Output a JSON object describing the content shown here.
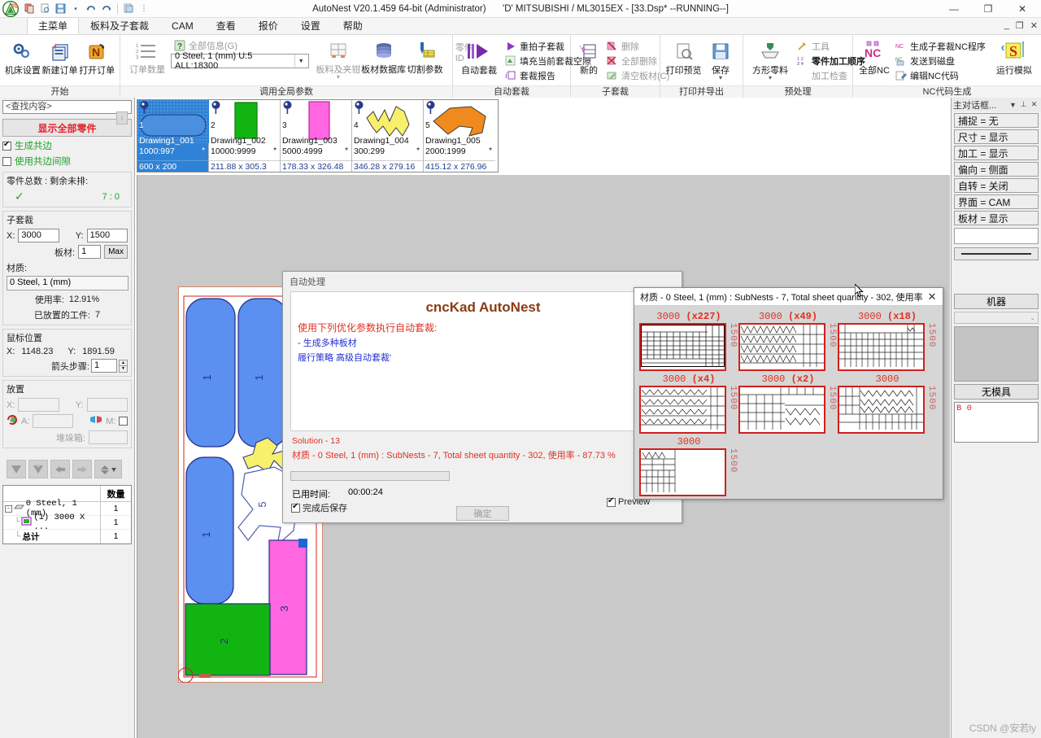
{
  "titlebar": {
    "app_title": "AutoNest V20.1.459 64-bit (Administrator)",
    "doc_title": "'D' MITSUBISHI / ML3015EX   - [33.Dsp* --RUNNING--]",
    "quick_access": [
      "copy-icon",
      "print-preview-icon",
      "save-icon",
      "dropdown-icon",
      "undo-icon",
      "redo-icon",
      "customize-icon",
      "more-icon"
    ],
    "minimize": "—",
    "maximize": "❐",
    "close": "✕",
    "mdi_minimize": "_",
    "mdi_restore": "❐",
    "mdi_close": "✕"
  },
  "tabs": [
    {
      "label": "主菜单",
      "active": true
    },
    {
      "label": "板料及子套裁",
      "active": false
    },
    {
      "label": "CAM",
      "active": false
    },
    {
      "label": "查看",
      "active": false
    },
    {
      "label": "报价",
      "active": false
    },
    {
      "label": "设置",
      "active": false
    },
    {
      "label": "帮助",
      "active": false
    }
  ],
  "ribbon": {
    "groups": [
      {
        "name": "开始",
        "label": "开始",
        "big": [
          {
            "label": "机床设置",
            "icon": "gears-icon"
          },
          {
            "label": "新建订单",
            "icon": "new-order-icon"
          },
          {
            "label": "打开订单",
            "icon": "open-order-icon"
          }
        ]
      },
      {
        "name": "调用全局参数",
        "label": "调用全局参数",
        "order_qty_label": "订单数量",
        "all_info_label": "全部信息(G)",
        "material_combo": "0  Steel, 1 (mm)    U:5 ALL:18300",
        "big": [
          {
            "label": "板料及夹钳",
            "icon": "sheet-clamp-icon",
            "dim": true
          },
          {
            "label": "板材数据库",
            "icon": "database-icon"
          },
          {
            "label": "切割参数",
            "icon": "cut-params-icon"
          }
        ],
        "part_id_label": "零件 ID"
      },
      {
        "name": "自动套裁",
        "label": "自动套裁",
        "big": [
          {
            "label": "自动套裁",
            "icon": "autonest-icon"
          }
        ],
        "small": [
          {
            "label": "重拍子套裁",
            "icon": "play-icon"
          },
          {
            "label": "填充当前套裁空隙",
            "icon": "fill-gap-icon"
          },
          {
            "label": "套裁报告",
            "icon": "report-icon"
          }
        ]
      },
      {
        "name": "子套裁",
        "label": "子套裁",
        "big": [
          {
            "label": "新的",
            "icon": "new-subnest-icon"
          }
        ],
        "small": [
          {
            "label": "删除",
            "icon": "delete-icon",
            "dim": true
          },
          {
            "label": "全部删除",
            "icon": "delete-all-icon",
            "dim": true
          },
          {
            "label": "清空板材(C)",
            "icon": "clear-sheet-icon",
            "dim": true
          }
        ]
      },
      {
        "name": "打印并导出",
        "label": "打印并导出",
        "big": [
          {
            "label": "打印预览",
            "icon": "print-preview-icon"
          },
          {
            "label": "保存",
            "icon": "save-icon"
          }
        ]
      },
      {
        "name": "预处理",
        "label": "预处理",
        "big": [
          {
            "label": "方形零料",
            "icon": "remnant-icon"
          }
        ],
        "small": [
          {
            "label": "工具",
            "icon": "tools-icon",
            "dim": true
          },
          {
            "label": "零件加工顺序",
            "icon": "part-order-icon"
          },
          {
            "label": "加工检查",
            "icon": "check-icon",
            "dim": true
          }
        ]
      },
      {
        "name": "NC代码生成",
        "label": "NC代码生成",
        "big": [
          {
            "label": "全部NC",
            "icon": "nc-all-icon"
          },
          {
            "label": "运行模拟",
            "icon": "simulate-icon"
          }
        ],
        "small": [
          {
            "label": "生成子套裁NC程序",
            "icon": "nc-generate-icon"
          },
          {
            "label": "发送到磁盘",
            "icon": "nc-send-icon"
          },
          {
            "label": "编辑NC代码",
            "icon": "nc-edit-icon"
          }
        ],
        "extra": [
          {
            "icon": "nc-settings-icon"
          },
          {
            "icon": "nc-list-icon"
          },
          {
            "icon": "nst-icon"
          }
        ]
      }
    ]
  },
  "left_panel": {
    "search_placeholder": "<查找内容>",
    "show_all_parts": "显示全部零件",
    "checkbox_common_edge": {
      "label": "生成共边",
      "checked": true
    },
    "checkbox_common_gap": {
      "label": "使用共边间隙",
      "checked": false
    },
    "info_button": "i",
    "totals_legend": "零件总数 : 剩余未排:",
    "totals_value": "7 : 0",
    "check_mark": "✓",
    "subnest_legend": "子套裁",
    "x_label": "X:",
    "x_value": "3000",
    "y_label": "Y:",
    "y_value": "1500",
    "sheet_label": "板材:",
    "sheet_value": "1",
    "max_button": "Max",
    "material_legend": "材质:",
    "material_value": "0  Steel, 1 (mm)",
    "usage_label": "使用率:",
    "usage_value": "12.91%",
    "placed_label": "已放置的工件:",
    "placed_value": "7",
    "mouse_legend": "鼠标位置",
    "mouse_x_label": "X:",
    "mouse_x_value": "1148.23",
    "mouse_y_label": "Y:",
    "mouse_y_value": "1891.59",
    "step_label": "箭头步骤:",
    "step_value": "1",
    "place_legend": "放置",
    "place_x_label": "X:",
    "place_y_label": "Y:",
    "angle_label": "A:",
    "mirror_label": "M:",
    "stack_label": "堆垛箱:",
    "tools": [
      "nest-down-icon",
      "nest-down-alt-icon",
      "move-left-icon",
      "move-right-icon",
      "sort-icon",
      "dropdown-icon"
    ],
    "tree": {
      "qty_header": "数量",
      "rows": [
        {
          "label": "0  Steel, 1 (mm)",
          "qty": "1",
          "icon": "sheet-icon",
          "expander": "-"
        },
        {
          "label": "(1) 3000 X ...",
          "qty": "1",
          "icon": "nest-icon",
          "indent": true
        },
        {
          "label": "总计",
          "qty": "1",
          "bold": true
        }
      ]
    }
  },
  "parts_strip": [
    {
      "index": "1",
      "name": "Drawing1_001",
      "qty": "1000:997",
      "size": "600 x 200",
      "star": "*",
      "selected": true,
      "shape": "rounded-rect",
      "color": "#5b8ff0"
    },
    {
      "index": "2",
      "name": "Drawing1_002",
      "qty": "10000:9999",
      "size": "211.88 x 305.3",
      "star": "*",
      "selected": false,
      "shape": "rect",
      "color": "#12b412"
    },
    {
      "index": "3",
      "name": "Drawing1_003",
      "qty": "5000:4999",
      "size": "178.33 x 326.48",
      "star": "*",
      "selected": false,
      "shape": "rect",
      "color": "#ff66e0"
    },
    {
      "index": "4",
      "name": "Drawing1_004",
      "qty": "300:299",
      "size": "346.28 x 279.16",
      "star": "*",
      "selected": false,
      "shape": "zigzag",
      "color": "#f7f06a"
    },
    {
      "index": "5",
      "name": "Drawing1_005",
      "qty": "2000:1999",
      "size": "415.12 x 276.96",
      "star": "*",
      "selected": false,
      "shape": "arrow",
      "color": "#f08a1e"
    }
  ],
  "dialog_autoprocess": {
    "header": "自动处理",
    "brand": "cncKad AutoNest",
    "red_line": "使用下列优化参数执行自动套裁:",
    "blue_lines": [
      "- 生成多种板材",
      "履行策略 高级自动套裁'"
    ],
    "solution": "Solution - 13",
    "material_result": "材质 - 0  Steel, 1 (mm) : SubNests - 7, Total sheet quantity - 302, 使用率 - 87.73 %",
    "elapsed_label": "已用时间:",
    "elapsed_value": "00:00:24",
    "save_after_label": "完成后保存",
    "save_after_checked": true,
    "preview_label": "Preview",
    "preview_checked": true,
    "ok_button": "确定"
  },
  "preview_popup": {
    "title": "材质 - 0  Steel, 1 (mm) : SubNests - 7, Total sheet quantity - 302, 使用率 -...",
    "close": "✕",
    "nests": [
      {
        "width": "3000",
        "mult": "(x227)",
        "height": "1500",
        "pattern": "rect-grid"
      },
      {
        "width": "3000",
        "mult": "(x49)",
        "height": "1500",
        "pattern": "zigzag-dense"
      },
      {
        "width": "3000",
        "mult": "(x18)",
        "height": "1500",
        "pattern": "rect-rows"
      },
      {
        "width": "3000",
        "mult": "(x4)",
        "height": "1500",
        "pattern": "arrow-dense"
      },
      {
        "width": "3000",
        "mult": "(x2)",
        "height": "1500",
        "pattern": "mixed"
      },
      {
        "width": "3000",
        "mult": "",
        "height": "1500",
        "pattern": "mixed-rows"
      },
      {
        "width": "3000",
        "mult": "",
        "height": "1500",
        "pattern": "partial"
      }
    ]
  },
  "right_panel": {
    "title": "主对话框...",
    "dropdown_icon": "▼",
    "pin_icon": "⊥",
    "close_icon": "✕",
    "items": [
      "捕捉 = 无",
      "尺寸 = 显示",
      "加工 = 显示",
      "偏向 = 侧面",
      "自转 = 关闭",
      "界面 = CAM",
      "板材 = 显示"
    ],
    "machine_button": "机器",
    "no_tool_button": "无模具",
    "tool_list_text": "B 0"
  },
  "canvas": {
    "sheet_parts": [
      {
        "label": "1",
        "color": "#5b8ff0",
        "shape": "rounded-rect"
      },
      {
        "label": "1",
        "color": "#5b8ff0",
        "shape": "rounded-rect"
      },
      {
        "label": "1",
        "color": "#5b8ff0",
        "shape": "rounded-rect"
      },
      {
        "label": "5",
        "color": "#ffffff",
        "shape": "arrow"
      },
      {
        "label": "4",
        "color": "#f7f06a",
        "shape": "zigzag"
      },
      {
        "label": "2",
        "color": "#12b412",
        "shape": "rect"
      },
      {
        "label": "3",
        "color": "#ff66e0",
        "shape": "rect"
      }
    ]
  },
  "watermark": "CSDN @安若ly"
}
